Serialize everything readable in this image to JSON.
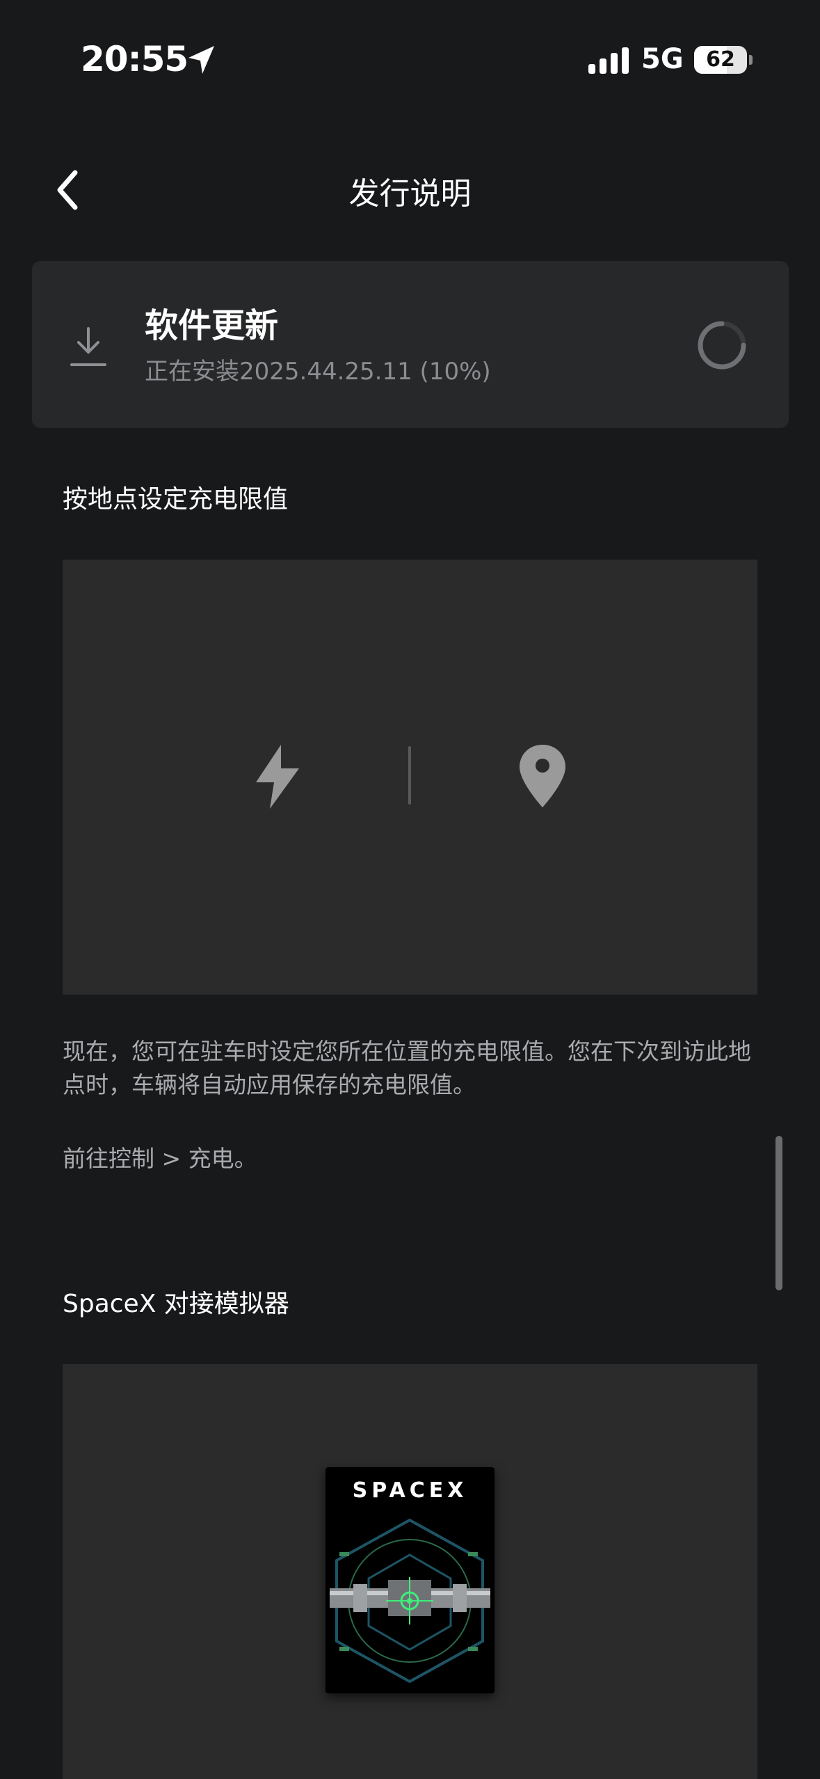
{
  "status_bar": {
    "time": "20:55",
    "network": "5G",
    "battery_level": "62",
    "battery_percent": 62
  },
  "header": {
    "title": "发行说明"
  },
  "update": {
    "title": "软件更新",
    "status": "正在安装2025.44.25.11 (10%)",
    "progress_percent": 10
  },
  "sections": [
    {
      "heading": "按地点设定充电限值",
      "paragraphs": [
        "现在，您可在驻车时设定您所在位置的充电限值。您在下次到访此地点时，车辆将自动应用保存的充电限值。",
        "前往控制 > 充电。"
      ],
      "icons": [
        "bolt-icon",
        "map-pin-icon"
      ]
    },
    {
      "heading": "SpaceX 对接模拟器",
      "image_logo": "SPACEX"
    }
  ],
  "colors": {
    "background": "#18191b",
    "card": "#27282a",
    "media": "#2b2b2c",
    "secondary_text": "#8b8d90"
  }
}
